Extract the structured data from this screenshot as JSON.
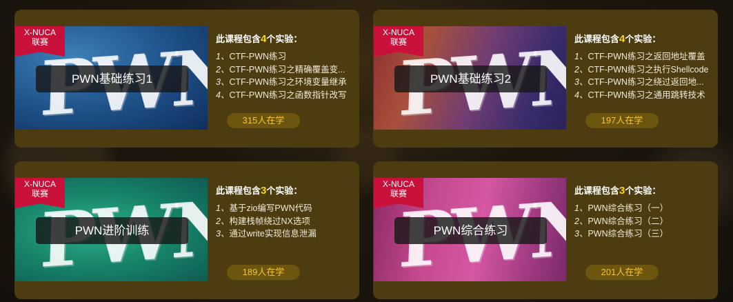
{
  "courses": [
    {
      "ribbon": [
        "X-NUCA",
        "联赛"
      ],
      "bg_word": "PWN",
      "title": "PWN基础练习1",
      "header_pre": "此课程包含",
      "count": "4",
      "header_post": "个实验：",
      "items": [
        {
          "idx": "1、",
          "text": "CTF-PWN练习"
        },
        {
          "idx": "2、",
          "text": "CTF-PWN练习之精确覆盖变..."
        },
        {
          "idx": "3、",
          "text": "CTF-PWN练习之环境变量继承"
        },
        {
          "idx": "4、",
          "text": "CTF-PWN练习之函数指针改写"
        }
      ],
      "learners": "315人在学"
    },
    {
      "ribbon": [
        "X-NUCA",
        "联赛"
      ],
      "bg_word": "PWN",
      "title": "PWN基础练习2",
      "header_pre": "此课程包含",
      "count": "4",
      "header_post": "个实验：",
      "items": [
        {
          "idx": "1、",
          "text": "CTF-PWN练习之返回地址覆盖"
        },
        {
          "idx": "2、",
          "text": "CTF-PWN练习之执行Shellcode"
        },
        {
          "idx": "3、",
          "text": "CTF-PWN练习之绕过返回地..."
        },
        {
          "idx": "4、",
          "text": "CTF-PWN练习之通用跳转技术"
        }
      ],
      "learners": "197人在学"
    },
    {
      "ribbon": [
        "X-NUCA",
        "联赛"
      ],
      "bg_word": "PWN",
      "title": "PWN进阶训练",
      "header_pre": "此课程包含",
      "count": "3",
      "header_post": "个实验：",
      "items": [
        {
          "idx": "1、",
          "text": "基于zio编写PWN代码"
        },
        {
          "idx": "2、",
          "text": "构建栈帧绕过NX选项"
        },
        {
          "idx": "3、",
          "text": "通过write实现信息泄漏"
        }
      ],
      "learners": "189人在学"
    },
    {
      "ribbon": [
        "X-NUCA",
        "联赛"
      ],
      "bg_word": "PWN",
      "title": "PWN综合练习",
      "header_pre": "此课程包含",
      "count": "3",
      "header_post": "个实验：",
      "items": [
        {
          "idx": "1、",
          "text": "PWN综合练习（一）"
        },
        {
          "idx": "2、",
          "text": "PWN综合练习（二）"
        },
        {
          "idx": "3、",
          "text": "PWN综合练习（三）"
        }
      ],
      "learners": "201人在学"
    }
  ],
  "colors": {
    "card_bg": "#4c3c0f",
    "ribbon": "#c8103a",
    "count_highlight": "#f5d80f",
    "learners_text": "#f5c431"
  }
}
